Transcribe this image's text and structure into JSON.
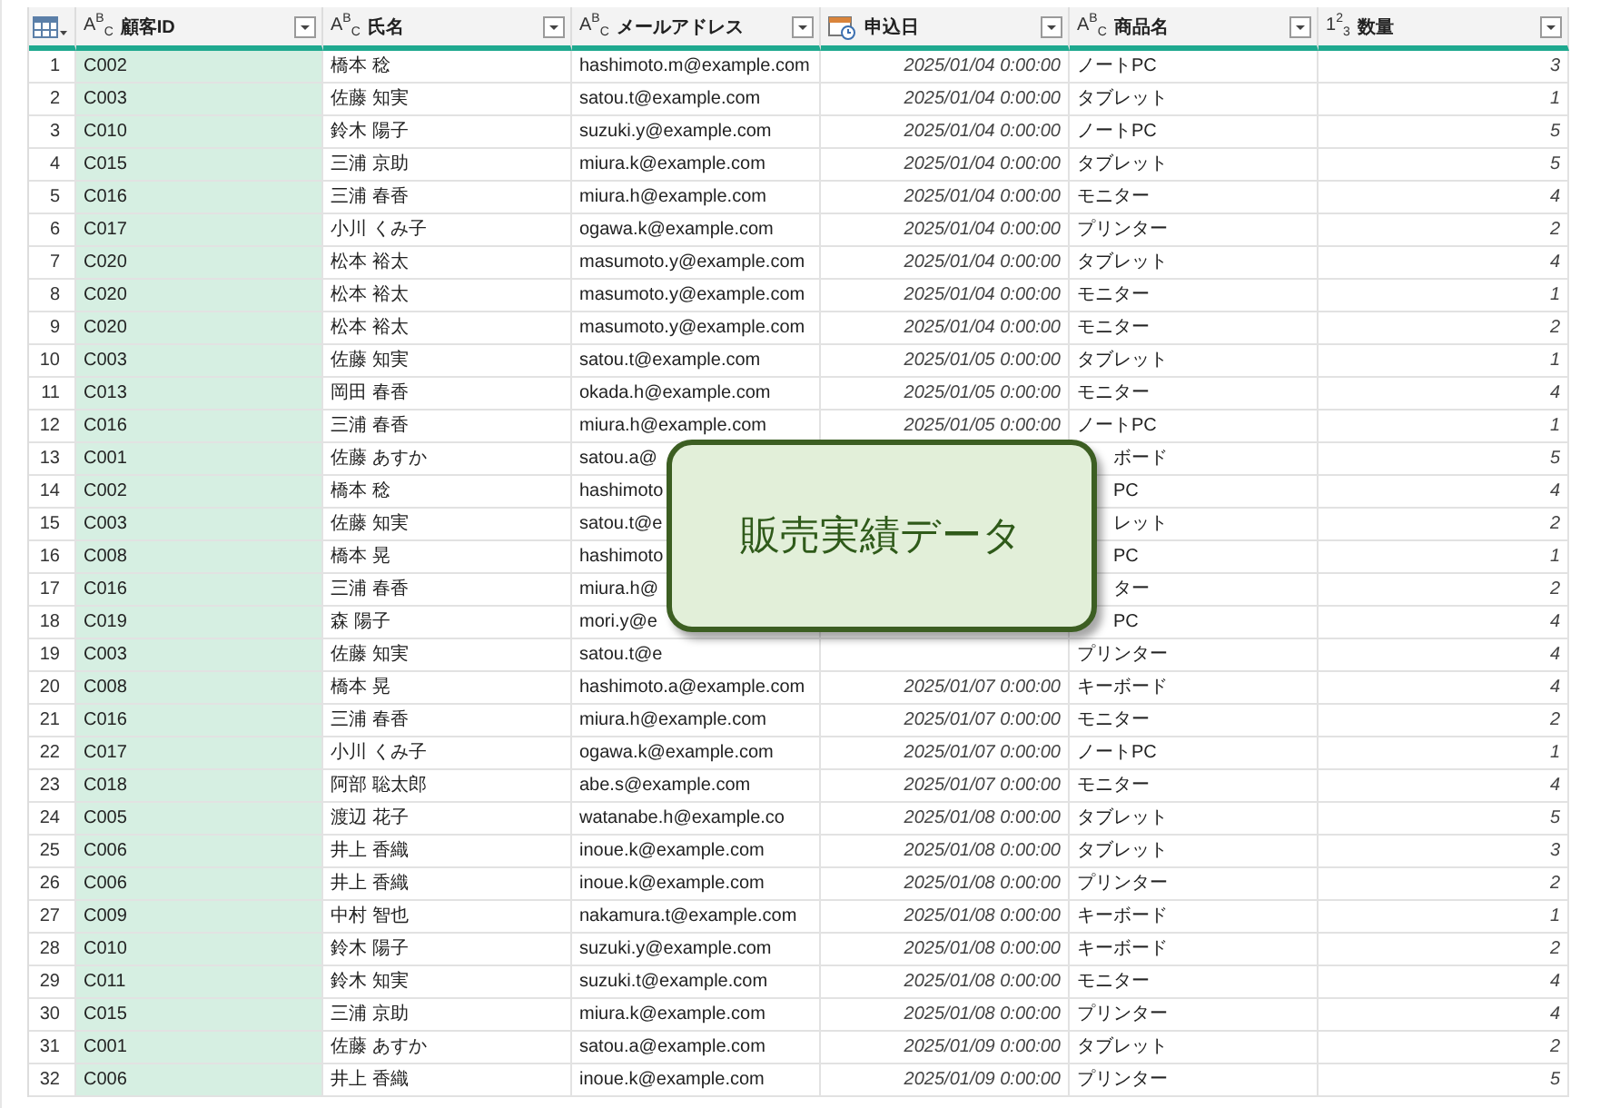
{
  "columns": [
    {
      "kind": "text",
      "type_label": "A$^{B}$$_{C}$",
      "title": "顧客ID",
      "selected": true
    },
    {
      "kind": "text",
      "type_label": "A$^{B}$$_{C}$",
      "title": "氏名",
      "selected": false
    },
    {
      "kind": "text",
      "type_label": "A$^{B}$$_{C}$",
      "title": "メールアドレス",
      "selected": false
    },
    {
      "kind": "date",
      "title": "申込日",
      "selected": false
    },
    {
      "kind": "text",
      "type_label": "A$^{B}$$_{C}$",
      "title": "商品名",
      "selected": false
    },
    {
      "kind": "number",
      "type_label": "1$^{2}$$_{3}$",
      "title": "数量",
      "selected": false
    }
  ],
  "rows": [
    {
      "n": "1",
      "cells": [
        "C002",
        "橋本 稔",
        "hashimoto.m@example.com",
        "2025/01/04 0:00:00",
        "ノートPC",
        "3"
      ],
      "covered": false
    },
    {
      "n": "2",
      "cells": [
        "C003",
        "佐藤 知実",
        "satou.t@example.com",
        "2025/01/04 0:00:00",
        "タブレット",
        "1"
      ],
      "covered": false
    },
    {
      "n": "3",
      "cells": [
        "C010",
        "鈴木 陽子",
        "suzuki.y@example.com",
        "2025/01/04 0:00:00",
        "ノートPC",
        "5"
      ],
      "covered": false
    },
    {
      "n": "4",
      "cells": [
        "C015",
        "三浦 京助",
        "miura.k@example.com",
        "2025/01/04 0:00:00",
        "タブレット",
        "5"
      ],
      "covered": false
    },
    {
      "n": "5",
      "cells": [
        "C016",
        "三浦 春香",
        "miura.h@example.com",
        "2025/01/04 0:00:00",
        "モニター",
        "4"
      ],
      "covered": false
    },
    {
      "n": "6",
      "cells": [
        "C017",
        "小川 くみ子",
        "ogawa.k@example.com",
        "2025/01/04 0:00:00",
        "プリンター",
        "2"
      ],
      "covered": false
    },
    {
      "n": "7",
      "cells": [
        "C020",
        "松本 裕太",
        "masumoto.y@example.com",
        "2025/01/04 0:00:00",
        "タブレット",
        "4"
      ],
      "covered": false
    },
    {
      "n": "8",
      "cells": [
        "C020",
        "松本 裕太",
        "masumoto.y@example.com",
        "2025/01/04 0:00:00",
        "モニター",
        "1"
      ],
      "covered": false
    },
    {
      "n": "9",
      "cells": [
        "C020",
        "松本 裕太",
        "masumoto.y@example.com",
        "2025/01/04 0:00:00",
        "モニター",
        "2"
      ],
      "covered": false
    },
    {
      "n": "10",
      "cells": [
        "C003",
        "佐藤 知実",
        "satou.t@example.com",
        "2025/01/05 0:00:00",
        "タブレット",
        "1"
      ],
      "covered": false
    },
    {
      "n": "11",
      "cells": [
        "C013",
        "岡田 春香",
        "okada.h@example.com",
        "2025/01/05 0:00:00",
        "モニター",
        "4"
      ],
      "covered": false
    },
    {
      "n": "12",
      "cells": [
        "C016",
        "三浦 春香",
        "miura.h@example.com",
        "2025/01/05 0:00:00",
        "ノートPC",
        "1"
      ],
      "covered": false
    },
    {
      "n": "13",
      "cells": [
        "C001",
        "佐藤 あすか",
        "satou.a@",
        null,
        "ボード",
        "5"
      ],
      "covered": true
    },
    {
      "n": "14",
      "cells": [
        "C002",
        "橋本 稔",
        "hashimoto",
        null,
        "PC",
        "4"
      ],
      "covered": true
    },
    {
      "n": "15",
      "cells": [
        "C003",
        "佐藤 知実",
        "satou.t@e",
        null,
        "レット",
        "2"
      ],
      "covered": true
    },
    {
      "n": "16",
      "cells": [
        "C008",
        "橋本 晃",
        "hashimoto",
        null,
        "PC",
        "1"
      ],
      "covered": true
    },
    {
      "n": "17",
      "cells": [
        "C016",
        "三浦 春香",
        "miura.h@",
        null,
        "ター",
        "2"
      ],
      "covered": true
    },
    {
      "n": "18",
      "cells": [
        "C019",
        "森 陽子",
        "mori.y@e",
        null,
        "PC",
        "4"
      ],
      "covered": true
    },
    {
      "n": "19",
      "cells": [
        "C003",
        "佐藤 知実",
        "satou.t@e",
        null,
        "プリンター",
        "4"
      ],
      "covered": false
    },
    {
      "n": "20",
      "cells": [
        "C008",
        "橋本 晃",
        "hashimoto.a@example.com",
        "2025/01/07 0:00:00",
        "キーボード",
        "4"
      ],
      "covered": false
    },
    {
      "n": "21",
      "cells": [
        "C016",
        "三浦 春香",
        "miura.h@example.com",
        "2025/01/07 0:00:00",
        "モニター",
        "2"
      ],
      "covered": false
    },
    {
      "n": "22",
      "cells": [
        "C017",
        "小川 くみ子",
        "ogawa.k@example.com",
        "2025/01/07 0:00:00",
        "ノートPC",
        "1"
      ],
      "covered": false
    },
    {
      "n": "23",
      "cells": [
        "C018",
        "阿部 聡太郎",
        "abe.s@example.com",
        "2025/01/07 0:00:00",
        "モニター",
        "4"
      ],
      "covered": false
    },
    {
      "n": "24",
      "cells": [
        "C005",
        "渡辺 花子",
        "watanabe.h@example.co",
        "2025/01/08 0:00:00",
        "タブレット",
        "5"
      ],
      "covered": false
    },
    {
      "n": "25",
      "cells": [
        "C006",
        "井上 香織",
        "inoue.k@example.com",
        "2025/01/08 0:00:00",
        "タブレット",
        "3"
      ],
      "covered": false
    },
    {
      "n": "26",
      "cells": [
        "C006",
        "井上 香織",
        "inoue.k@example.com",
        "2025/01/08 0:00:00",
        "プリンター",
        "2"
      ],
      "covered": false
    },
    {
      "n": "27",
      "cells": [
        "C009",
        "中村 智也",
        "nakamura.t@example.com",
        "2025/01/08 0:00:00",
        "キーボード",
        "1"
      ],
      "covered": false
    },
    {
      "n": "28",
      "cells": [
        "C010",
        "鈴木 陽子",
        "suzuki.y@example.com",
        "2025/01/08 0:00:00",
        "キーボード",
        "2"
      ],
      "covered": false
    },
    {
      "n": "29",
      "cells": [
        "C011",
        "鈴木 知実",
        "suzuki.t@example.com",
        "2025/01/08 0:00:00",
        "モニター",
        "4"
      ],
      "covered": false
    },
    {
      "n": "30",
      "cells": [
        "C015",
        "三浦 京助",
        "miura.k@example.com",
        "2025/01/08 0:00:00",
        "プリンター",
        "4"
      ],
      "covered": false
    },
    {
      "n": "31",
      "cells": [
        "C001",
        "佐藤 あすか",
        "satou.a@example.com",
        "2025/01/09 0:00:00",
        "タブレット",
        "2"
      ],
      "covered": false
    },
    {
      "n": "32",
      "cells": [
        "C006",
        "井上 香織",
        "inoue.k@example.com",
        "2025/01/09 0:00:00",
        "プリンター",
        "5"
      ],
      "covered": false
    }
  ],
  "callout": {
    "text": "販売実績データ"
  }
}
